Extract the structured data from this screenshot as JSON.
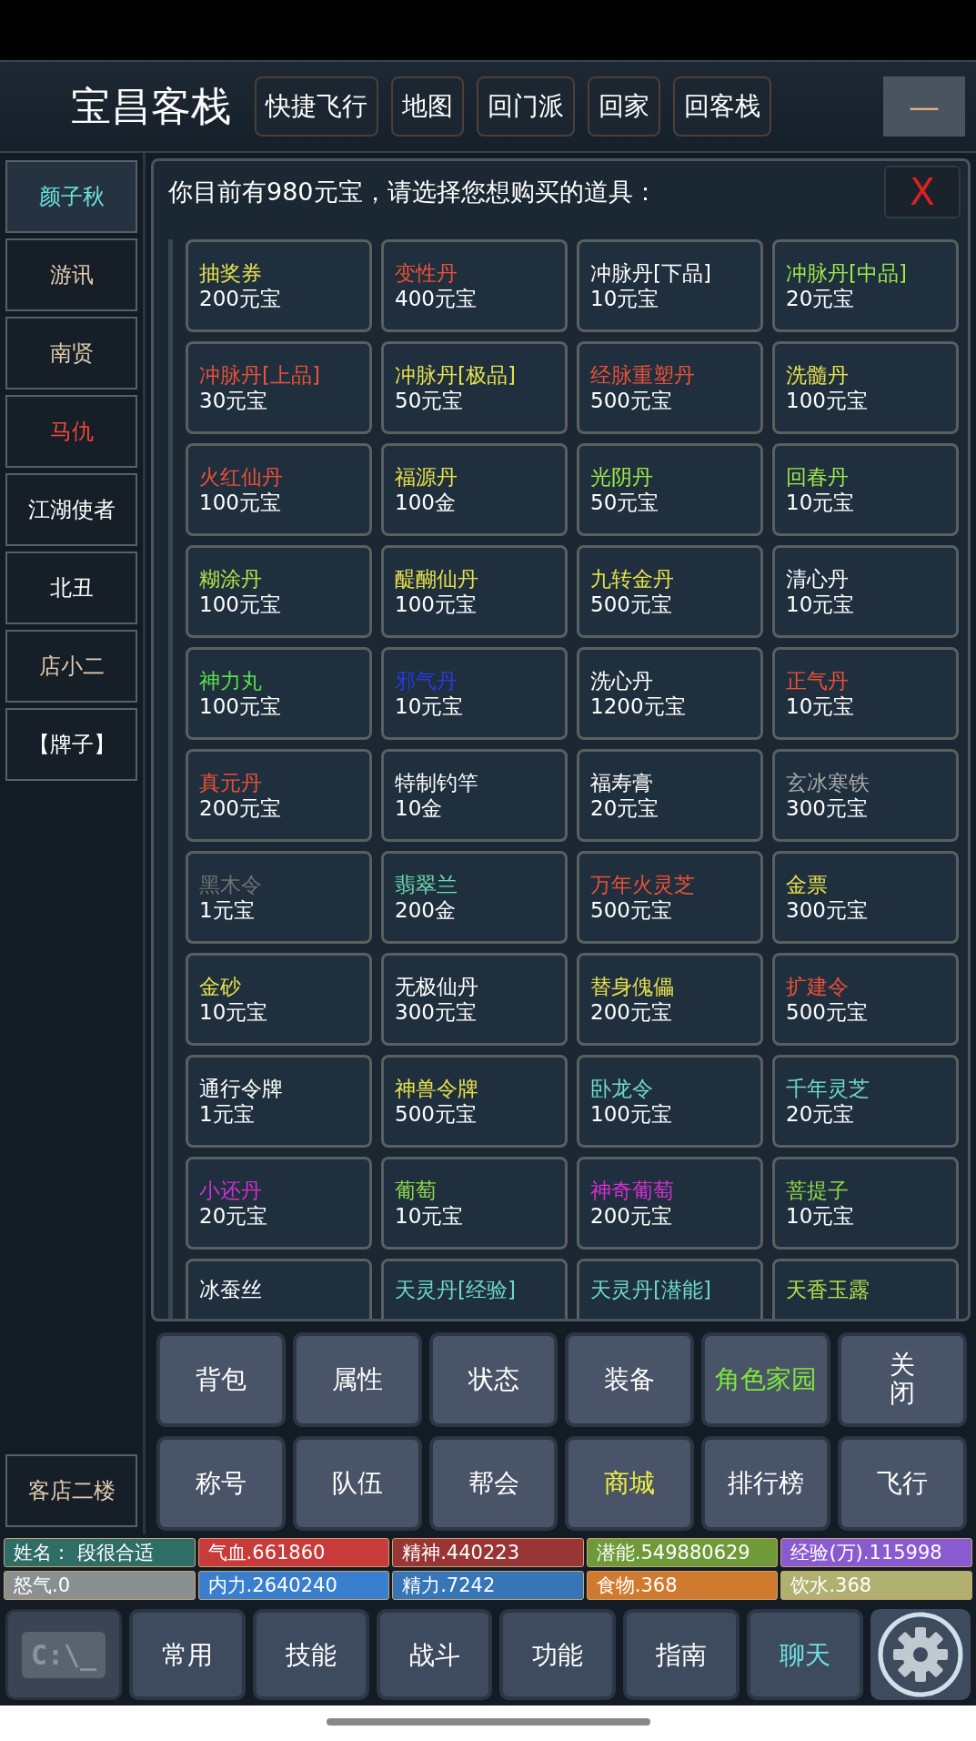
{
  "header": {
    "title": "宝昌客栈",
    "buttons": [
      "快捷飞行",
      "地图",
      "回门派",
      "回家",
      "回客栈"
    ],
    "minimize": "—"
  },
  "sidebar": {
    "items": [
      {
        "label": "颜子秋",
        "color": "#6ee0e0",
        "selected": true
      },
      {
        "label": "游讯",
        "color": "#e0ccb0",
        "selected": false
      },
      {
        "label": "南贤",
        "color": "#e0ccb0",
        "selected": false
      },
      {
        "label": "马仇",
        "color": "#f04a3a",
        "selected": false
      },
      {
        "label": "江湖使者",
        "color": "#ffffff",
        "selected": false
      },
      {
        "label": "北丑",
        "color": "#ffffff",
        "selected": false
      },
      {
        "label": "店小二",
        "color": "#e0ccb0",
        "selected": false
      },
      {
        "label": "【牌子】",
        "color": "#ffffff",
        "selected": false
      }
    ],
    "floor": "客店二楼"
  },
  "shop": {
    "prompt": "你目前有980元宝，请选择您想购买的道具：",
    "close": "X",
    "items": [
      {
        "name": "抽奖券",
        "price": "200元宝",
        "color": "#e6e04c"
      },
      {
        "name": "变性丹",
        "price": "400元宝",
        "color": "#ec5038"
      },
      {
        "name": "冲脉丹[下品]",
        "price": "10元宝",
        "color": "#ffffff"
      },
      {
        "name": "冲脉丹[中品]",
        "price": "20元宝",
        "color": "#9ce84a"
      },
      {
        "name": "冲脉丹[上品]",
        "price": "30元宝",
        "color": "#ec5038"
      },
      {
        "name": "冲脉丹[极品]",
        "price": "50元宝",
        "color": "#e6e04c"
      },
      {
        "name": "经脉重塑丹",
        "price": "500元宝",
        "color": "#ec5038"
      },
      {
        "name": "洗髓丹",
        "price": "100元宝",
        "color": "#e6e04c"
      },
      {
        "name": "火红仙丹",
        "price": "100元宝",
        "color": "#ec5038"
      },
      {
        "name": "福源丹",
        "price": "100金",
        "color": "#e6e04c"
      },
      {
        "name": "光阴丹",
        "price": "50元宝",
        "color": "#9ce84a"
      },
      {
        "name": "回春丹",
        "price": "10元宝",
        "color": "#9ce84a"
      },
      {
        "name": "糊涂丹",
        "price": "100元宝",
        "color": "#b4e04a"
      },
      {
        "name": "醍醐仙丹",
        "price": "100元宝",
        "color": "#e6e04c"
      },
      {
        "name": "九转金丹",
        "price": "500元宝",
        "color": "#e6e04c"
      },
      {
        "name": "清心丹",
        "price": "10元宝",
        "color": "#ffffff"
      },
      {
        "name": "神力丸",
        "price": "100元宝",
        "color": "#5ae04a"
      },
      {
        "name": "邪气丹",
        "price": "10元宝",
        "color": "#2a3ae0"
      },
      {
        "name": "洗心丹",
        "price": "1200元宝",
        "color": "#ffffff"
      },
      {
        "name": "正气丹",
        "price": "10元宝",
        "color": "#ec5038"
      },
      {
        "name": "真元丹",
        "price": "200元宝",
        "color": "#ec5038"
      },
      {
        "name": "特制钓竿",
        "price": "10金",
        "color": "#ffffff"
      },
      {
        "name": "福寿膏",
        "price": "20元宝",
        "color": "#ffffff"
      },
      {
        "name": "玄冰寒铁",
        "price": "300元宝",
        "color": "#a8a8a8"
      },
      {
        "name": "黑木令",
        "price": "1元宝",
        "color": "#707070"
      },
      {
        "name": "翡翠兰",
        "price": "200金",
        "color": "#6ed8b0"
      },
      {
        "name": "万年火灵芝",
        "price": "500元宝",
        "color": "#ec5038"
      },
      {
        "name": "金票",
        "price": "300元宝",
        "color": "#e6e04c"
      },
      {
        "name": "金砂",
        "price": "10元宝",
        "color": "#e6e04c"
      },
      {
        "name": "无极仙丹",
        "price": "300元宝",
        "color": "#ffffff"
      },
      {
        "name": "替身傀儡",
        "price": "200元宝",
        "color": "#e6e04c"
      },
      {
        "name": "扩建令",
        "price": "500元宝",
        "color": "#ec5038"
      },
      {
        "name": "通行令牌",
        "price": "1元宝",
        "color": "#ffffff"
      },
      {
        "name": "神兽令牌",
        "price": "500元宝",
        "color": "#e6e04c"
      },
      {
        "name": "卧龙令",
        "price": "100元宝",
        "color": "#6ed8c8"
      },
      {
        "name": "千年灵芝",
        "price": "20元宝",
        "color": "#6ed8c8"
      },
      {
        "name": "小还丹",
        "price": "20元宝",
        "color": "#d030d0"
      },
      {
        "name": "葡萄",
        "price": "10元宝",
        "color": "#8ed84a"
      },
      {
        "name": "神奇葡萄",
        "price": "200元宝",
        "color": "#d030d0"
      },
      {
        "name": "菩提子",
        "price": "10元宝",
        "color": "#8ed84a"
      },
      {
        "name": "冰蚕丝",
        "color": "#ffffff"
      },
      {
        "name": "天灵丹[经验]",
        "color": "#6ed8c8"
      },
      {
        "name": "天灵丹[潜能]",
        "color": "#6ed8c8"
      },
      {
        "name": "天香玉露",
        "color": "#b4e04a"
      }
    ]
  },
  "menu": [
    {
      "label": "背包",
      "color": "#ffffff"
    },
    {
      "label": "属性",
      "color": "#ffffff"
    },
    {
      "label": "状态",
      "color": "#ffffff"
    },
    {
      "label": "装备",
      "color": "#ffffff"
    },
    {
      "label": "角色家园",
      "color": "#7ee83a"
    },
    {
      "label": "关闭",
      "color": "#ffffff"
    },
    {
      "label": "称号",
      "color": "#ffffff"
    },
    {
      "label": "队伍",
      "color": "#ffffff"
    },
    {
      "label": "帮会",
      "color": "#ffffff"
    },
    {
      "label": "商城",
      "color": "#f0f040"
    },
    {
      "label": "排行榜",
      "color": "#ffffff"
    },
    {
      "label": "飞行",
      "color": "#ffffff"
    }
  ],
  "stats": [
    {
      "label": "姓名：  段很合适",
      "color": "#2f6e66"
    },
    {
      "label": "气血.661860",
      "color": "#c93a3a"
    },
    {
      "label": "精神.440223",
      "color": "#9a3535"
    },
    {
      "label": "潜能.549880629",
      "color": "#6f9a3a"
    },
    {
      "label": "经验(万).115998",
      "color": "#8a5ad0"
    },
    {
      "label": "怒气.0",
      "color": "#8a9090"
    },
    {
      "label": "内力.2640240",
      "color": "#3a7fcf"
    },
    {
      "label": "精力.7242",
      "color": "#3575b8"
    },
    {
      "label": "食物.368",
      "color": "#d07a30"
    },
    {
      "label": "饮水.368",
      "color": "#b0b070"
    }
  ],
  "bottom_bar": {
    "console": "C:\\_",
    "tabs": [
      {
        "label": "常用",
        "color": "#ffffff"
      },
      {
        "label": "技能",
        "color": "#ffffff"
      },
      {
        "label": "战斗",
        "color": "#ffffff"
      },
      {
        "label": "功能",
        "color": "#ffffff"
      },
      {
        "label": "指南",
        "color": "#ffffff"
      },
      {
        "label": "聊天",
        "color": "#6ee0e0"
      }
    ]
  }
}
